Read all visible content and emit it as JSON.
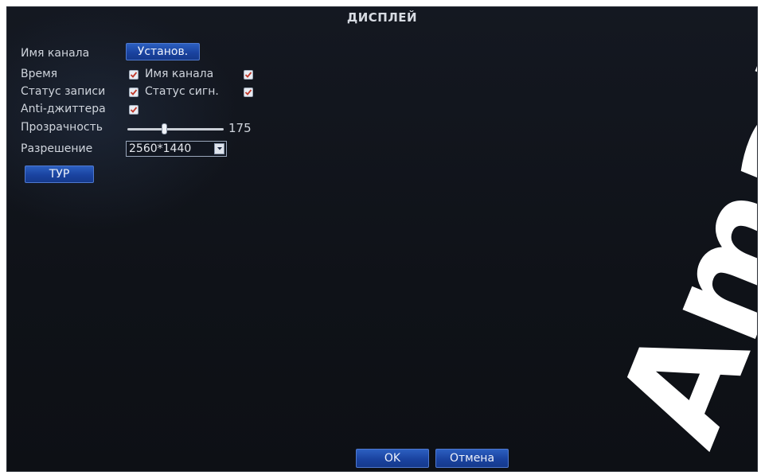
{
  "title": "ДИСПЛЕЙ",
  "rows": {
    "channel_name_label": "Имя канала",
    "set_button": "Установ.",
    "time_label": "Время",
    "time_checked": true,
    "channel_name2_label": "Имя канала",
    "channel_name2_checked": true,
    "rec_status_label": "Статус записи",
    "rec_status_checked": true,
    "signal_status_label": "Статус сигн.",
    "signal_status_checked": true,
    "antijitter_label": "Anti-джиттера",
    "antijitter_checked": true,
    "transparency_label": "Прозрачность",
    "transparency_value": "175",
    "transparency_fraction": 0.38,
    "resolution_label": "Разрешение",
    "resolution_value": "2560*1440"
  },
  "tour_button": "ТУР",
  "footer": {
    "ok": "OK",
    "cancel": "Отмена"
  },
  "watermark_text": "Amate",
  "colors": {
    "accent": "#1a43a0",
    "background": "#101318"
  }
}
